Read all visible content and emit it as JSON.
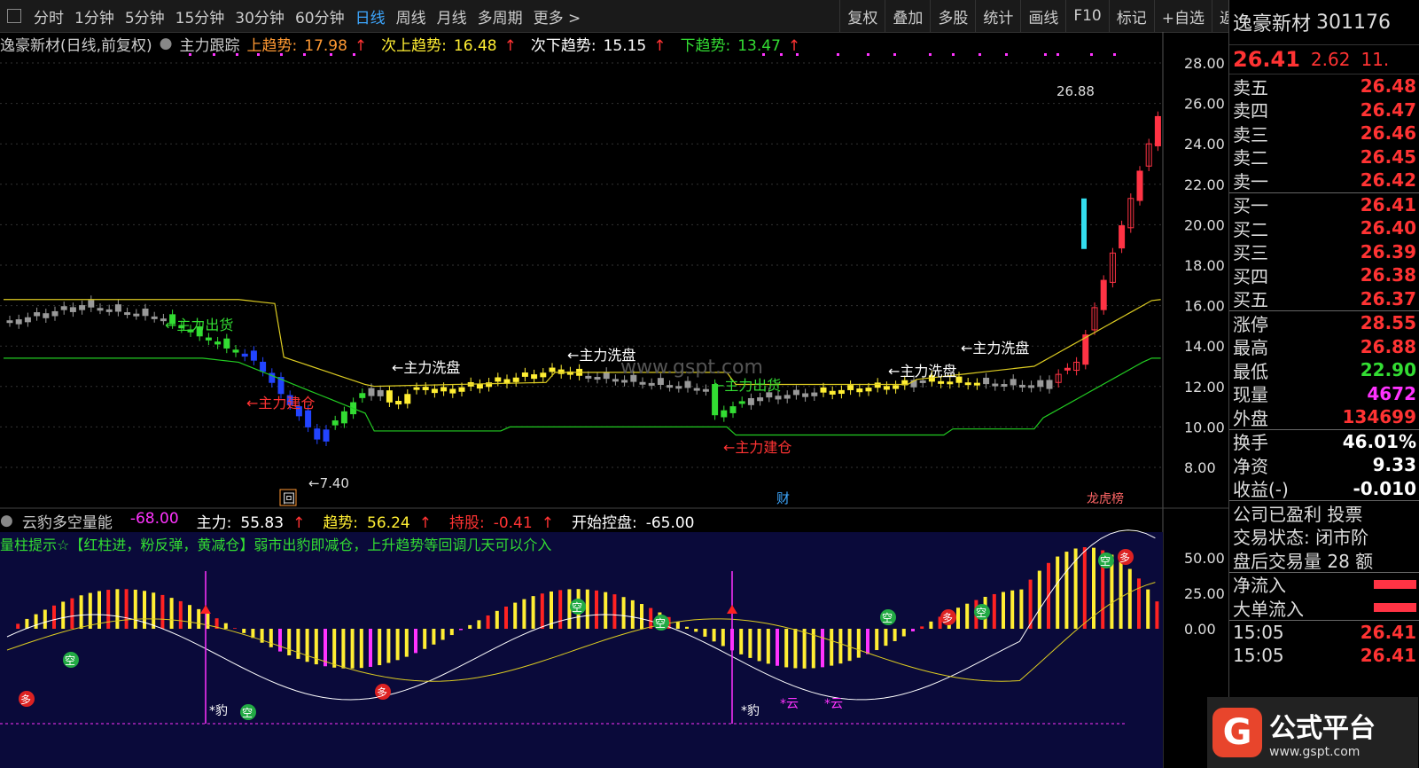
{
  "toolbar": {
    "periods": [
      "分时",
      "1分钟",
      "5分钟",
      "15分钟",
      "30分钟",
      "60分钟",
      "日线",
      "周线",
      "月线",
      "多周期",
      "更多 >"
    ],
    "active_period": "日线",
    "buttons": [
      "复权",
      "叠加",
      "多股",
      "统计",
      "画线",
      "F10",
      "标记",
      "+自选",
      "返回"
    ]
  },
  "main_chart": {
    "title": "逸豪新材(日线,前复权)",
    "indicator": "主力跟踪",
    "values": [
      {
        "label": "上趋势:",
        "value": "17.98",
        "color": "#ff9933"
      },
      {
        "label": "次上趋势:",
        "value": "16.48",
        "color": "#ffee33"
      },
      {
        "label": "次下趋势:",
        "value": "15.15",
        "color": "#ffffff"
      },
      {
        "label": "下趋势:",
        "value": "13.47",
        "color": "#33dd33"
      }
    ],
    "y_ticks": [
      "28.00",
      "26.00",
      "24.00",
      "22.00",
      "20.00",
      "18.00",
      "16.00",
      "14.00",
      "12.00",
      "10.00",
      "8.00"
    ],
    "annotations": {
      "out1": "←主力出货",
      "build1": "←主力建仓",
      "wash1": "←主力洗盘",
      "wash2": "←主力洗盘",
      "out2": "←主力出货",
      "build2": "←主力建仓",
      "wash3": "←主力洗盘",
      "wash4": "←主力洗盘",
      "low": "←7.40",
      "high": "26.88"
    },
    "markers": {
      "hui": "回",
      "cai": "财",
      "longhu": "龙虎榜"
    },
    "watermark": "www.gspt.com"
  },
  "sub_chart": {
    "title": "云豹多空量能",
    "values": [
      {
        "label": "",
        "value": "-68.00",
        "color": "#ff33ff"
      },
      {
        "label": "主力:",
        "value": "55.83",
        "color": "#ffffff"
      },
      {
        "label": "趋势:",
        "value": "56.24",
        "color": "#ffee33"
      },
      {
        "label": "持股:",
        "value": "-0.41",
        "color": "#ff3333"
      },
      {
        "label": "开始控盘:",
        "value": "-65.00",
        "color": "#ffffff"
      }
    ],
    "hint": "量柱提示☆【红柱进，粉反弹，黄减仓】弱市出豹即减仓，上升趋势等回调几天可以介入",
    "y_ticks": [
      "50.00",
      "25.00",
      "0.00"
    ],
    "labels": {
      "kong": "空",
      "duo": "多",
      "bao": "*豹",
      "yun": "*云"
    }
  },
  "quote": {
    "name": "逸豪新材",
    "code": "301176",
    "price": "26.41",
    "change": "2.62",
    "pct": "11.",
    "asks": [
      {
        "label": "卖五",
        "price": "26.48"
      },
      {
        "label": "卖四",
        "price": "26.47"
      },
      {
        "label": "卖三",
        "price": "26.46"
      },
      {
        "label": "卖二",
        "price": "26.45"
      },
      {
        "label": "卖一",
        "price": "26.42"
      }
    ],
    "bids": [
      {
        "label": "买一",
        "price": "26.41"
      },
      {
        "label": "买二",
        "price": "26.40"
      },
      {
        "label": "买三",
        "price": "26.39"
      },
      {
        "label": "买四",
        "price": "26.38"
      },
      {
        "label": "买五",
        "price": "26.37"
      }
    ],
    "stats1": [
      {
        "label": "涨停",
        "value": "28.55",
        "color": "#ff3333"
      },
      {
        "label": "最高",
        "value": "26.88",
        "color": "#ff3333"
      },
      {
        "label": "最低",
        "value": "22.90",
        "color": "#33dd33"
      },
      {
        "label": "现量",
        "value": "4672",
        "color": "#ff33ff"
      },
      {
        "label": "外盘",
        "value": "134699",
        "color": "#ff3333"
      }
    ],
    "stats2": [
      {
        "label": "换手",
        "value": "46.01%",
        "color": "#ffffff"
      },
      {
        "label": "净资",
        "value": "9.33",
        "color": "#ffffff"
      },
      {
        "label": "收益(-)",
        "value": "-0.010",
        "color": "#ffffff"
      }
    ],
    "info": [
      "公司已盈利 投票",
      "交易状态: 闭市阶",
      "盘后交易量 28 额"
    ],
    "flows": [
      "净流入",
      "大单流入"
    ],
    "ticks": [
      {
        "time": "15:05",
        "price": "26.41"
      },
      {
        "time": "15:05",
        "price": "26.41"
      }
    ],
    "logo": {
      "text": "公式平台",
      "url": "www.gspt.com",
      "letter": "G"
    }
  }
}
